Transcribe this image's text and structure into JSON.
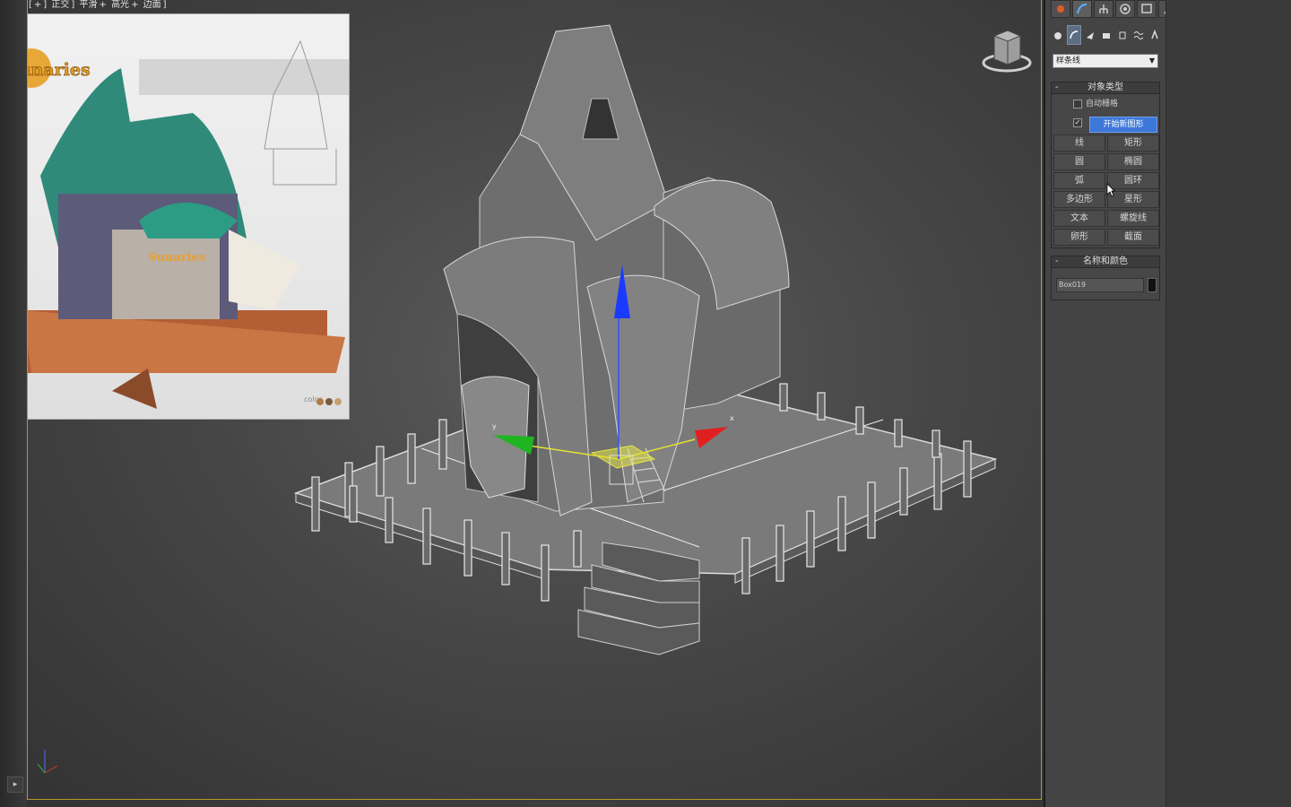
{
  "viewport": {
    "label": [
      "[",
      "+",
      "]",
      "正交",
      "]",
      "平滑",
      "+",
      "高光",
      "+",
      "边面",
      "]"
    ],
    "gizmo_axes": {
      "x": "x",
      "y": "y",
      "z": "z"
    }
  },
  "reference_image": {
    "logo_text": "Sunaries",
    "color_label": "color"
  },
  "command_panel": {
    "category_dropdown": "样条线",
    "object_type": {
      "title": "对象类型",
      "auto_grid_label": "自动栅格",
      "start_new_shape_label": "开始新图形",
      "start_new_shape_checked": "✓",
      "buttons": [
        {
          "id": "line",
          "label": "线"
        },
        {
          "id": "rectangle",
          "label": "矩形"
        },
        {
          "id": "circle",
          "label": "圆"
        },
        {
          "id": "ellipse",
          "label": "椭圆"
        },
        {
          "id": "arc",
          "label": "弧"
        },
        {
          "id": "donut",
          "label": "圆环"
        },
        {
          "id": "ngon",
          "label": "多边形"
        },
        {
          "id": "star",
          "label": "星形"
        },
        {
          "id": "text",
          "label": "文本"
        },
        {
          "id": "helix",
          "label": "螺旋线"
        },
        {
          "id": "egg",
          "label": "卵形"
        },
        {
          "id": "section",
          "label": "截面"
        }
      ]
    },
    "name_and_color": {
      "title": "名称和颜色",
      "object_name": "Box019",
      "color": "#111111"
    }
  },
  "colors": {
    "accent": "#3d78d8",
    "viewport_border": "#b59a2a",
    "gizmo_x": "#cc2020",
    "gizmo_y": "#20b020",
    "gizmo_z": "#2040ee"
  }
}
